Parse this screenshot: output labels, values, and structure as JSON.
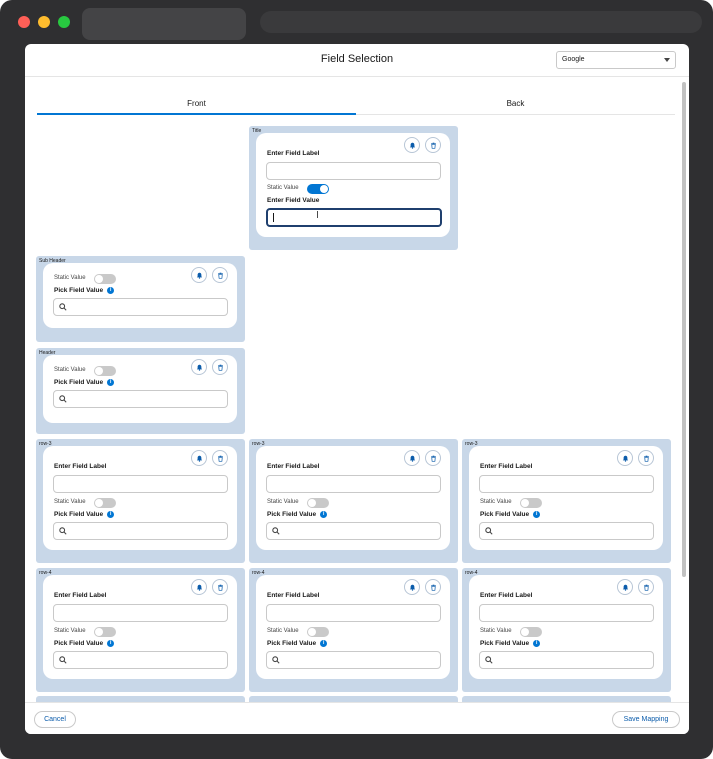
{
  "window": {
    "title": "Field Selection"
  },
  "header": {
    "select_value": "Google"
  },
  "tabs": [
    {
      "label": "Front"
    },
    {
      "label": "Back"
    }
  ],
  "labels": {
    "enter_field_label": "Enter Field Label",
    "enter_field_value": "Enter Field Value",
    "pick_field_value": "Pick Field Value",
    "static_value": "Static Value",
    "info": "i"
  },
  "sections": {
    "title": "Title",
    "sub_header": "Sub Header",
    "header": "Header",
    "row3": "row-3",
    "row4": "row-4"
  },
  "toggles": {
    "title_static_value": true,
    "others_static_value": false
  },
  "footer": {
    "cancel_label": "Cancel",
    "save_label": "Save Mapping"
  },
  "colors": {
    "accent": "#0176d3",
    "tile_bg": "#c8d7e8",
    "focus_border": "#1f3f6e"
  },
  "icons": [
    "bell-icon",
    "trash-icon",
    "search-icon",
    "info-icon",
    "chevron-down-icon"
  ]
}
